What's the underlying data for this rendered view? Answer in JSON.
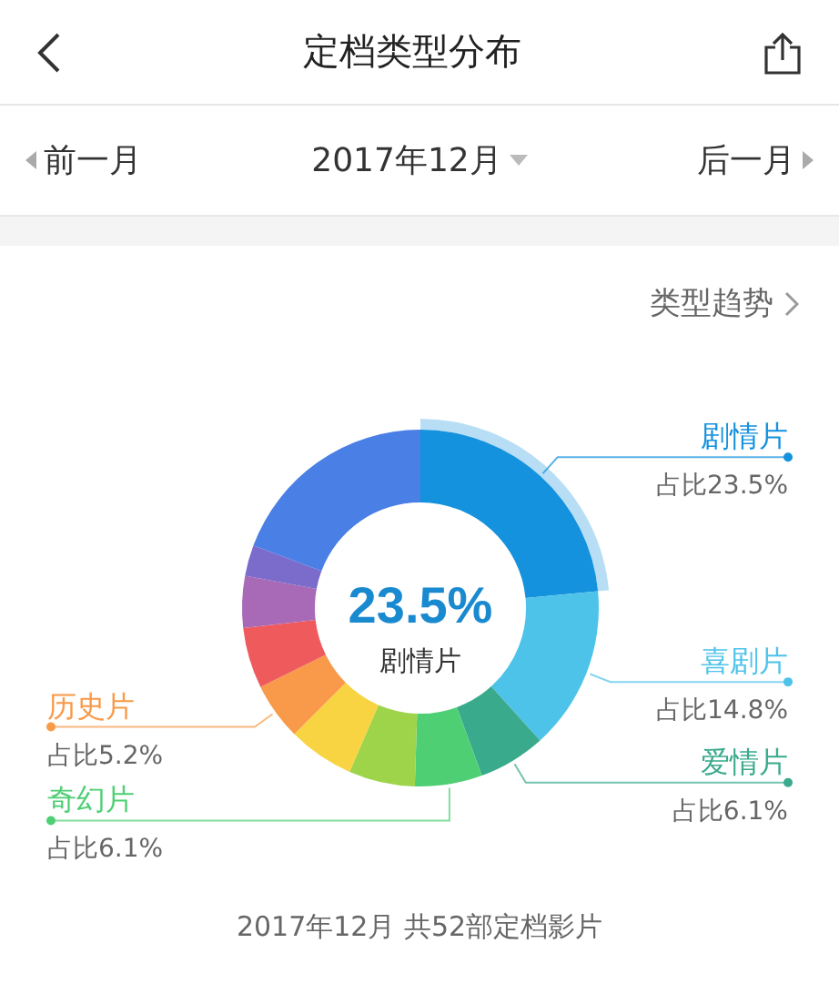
{
  "header": {
    "title": "定档类型分布"
  },
  "month_nav": {
    "previous": "前一月",
    "current": "2017年12月",
    "next": "后一月"
  },
  "trend_link": "类型趋势",
  "center": {
    "value": "23.5%",
    "label": "剧情片"
  },
  "chart_data": {
    "type": "donut",
    "categories": [
      "剧情片",
      "喜剧片",
      "爱情片",
      "奇幻片",
      null,
      null,
      "历史片",
      null,
      null,
      null,
      null
    ],
    "value_labels": [
      "占比23.5%",
      "占比14.8%",
      "占比6.1%",
      "占比6.1%",
      null,
      null,
      "占比5.2%",
      null,
      null,
      null,
      null
    ],
    "colors": [
      "#1592dd",
      "#4ec3ea",
      "#3aaa8c",
      "#4fcf74",
      "#9ed44a",
      "#f8d443",
      "#f89a4a",
      "#ef5a5d",
      "#a86ab6",
      "#7b6bcb",
      "#4a7fe6"
    ],
    "series": [
      {
        "values": [
          23.5,
          14.8,
          6.1,
          6.1,
          6.0,
          6.0,
          5.2,
          5.5,
          4.7,
          2.8,
          19.3
        ]
      }
    ]
  },
  "footer": "2017年12月 共52部定档影片"
}
